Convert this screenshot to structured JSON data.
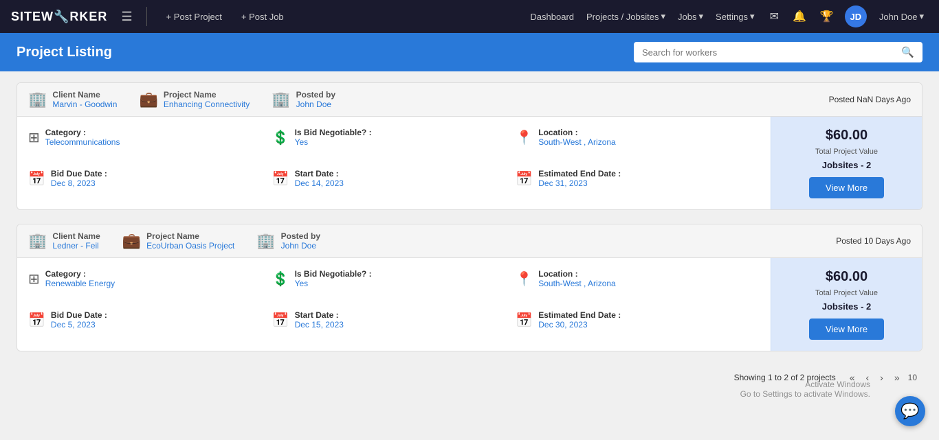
{
  "navbar": {
    "logo_text": "SITEW",
    "logo_accent": "🔧",
    "logo_rest": "RKER",
    "menu_icon": "☰",
    "post_project": "+ Post Project",
    "post_job": "+ Post Job",
    "links": [
      {
        "label": "Dashboard",
        "has_dropdown": false
      },
      {
        "label": "Projects / Jobsites",
        "has_dropdown": true
      },
      {
        "label": "Jobs",
        "has_dropdown": true
      },
      {
        "label": "Settings",
        "has_dropdown": true
      }
    ],
    "mail_icon": "✉",
    "bell_icon": "🔔",
    "trophy_icon": "🏆",
    "avatar_initials": "JD",
    "user_name": "John Doe"
  },
  "page_header": {
    "title": "Project Listing",
    "search_placeholder": "Search for workers"
  },
  "projects": [
    {
      "client_name_label": "Client Name",
      "client_name": "Marvin - Goodwin",
      "project_name_label": "Project Name",
      "project_name": "Enhancing Connectivity",
      "posted_by_label": "Posted by",
      "posted_by": "John Doe",
      "posted_ago": "Posted  NaN Days Ago",
      "category_label": "Category :",
      "category": "Telecommunications",
      "is_bid_label": "Is Bid Negotiable? :",
      "is_bid": "Yes",
      "location_label": "Location :",
      "location": "South-West , Arizona",
      "bid_due_label": "Bid Due Date :",
      "bid_due": "Dec 8, 2023",
      "start_date_label": "Start Date :",
      "start_date": "Dec 14, 2023",
      "end_date_label": "Estimated End Date :",
      "end_date": "Dec 31, 2023",
      "value": "$60.00",
      "total_value_label": "Total Project Value",
      "jobsites_label": "Jobsites - 2",
      "view_more": "View More"
    },
    {
      "client_name_label": "Client Name",
      "client_name": "Ledner - Feil",
      "project_name_label": "Project Name",
      "project_name": "EcoUrban Oasis Project",
      "posted_by_label": "Posted by",
      "posted_by": "John Doe",
      "posted_ago": "Posted  10 Days Ago",
      "category_label": "Category :",
      "category": "Renewable Energy",
      "is_bid_label": "Is Bid Negotiable? :",
      "is_bid": "Yes",
      "location_label": "Location :",
      "location": "South-West , Arizona",
      "bid_due_label": "Bid Due Date :",
      "bid_due": "Dec 5, 2023",
      "start_date_label": "Start Date :",
      "start_date": "Dec 15, 2023",
      "end_date_label": "Estimated End Date :",
      "end_date": "Dec 30, 2023",
      "value": "$60.00",
      "total_value_label": "Total Project Value",
      "jobsites_label": "Jobsites - 2",
      "view_more": "View More"
    }
  ],
  "pagination": {
    "showing": "Showing 1 to 2 of 2 projects",
    "first": "«",
    "prev": "‹",
    "next": "›",
    "last": "»",
    "page_count": "10"
  },
  "windows_watermark": {
    "line1": "Activate Windows",
    "line2": "Go to Settings to activate Windows."
  }
}
